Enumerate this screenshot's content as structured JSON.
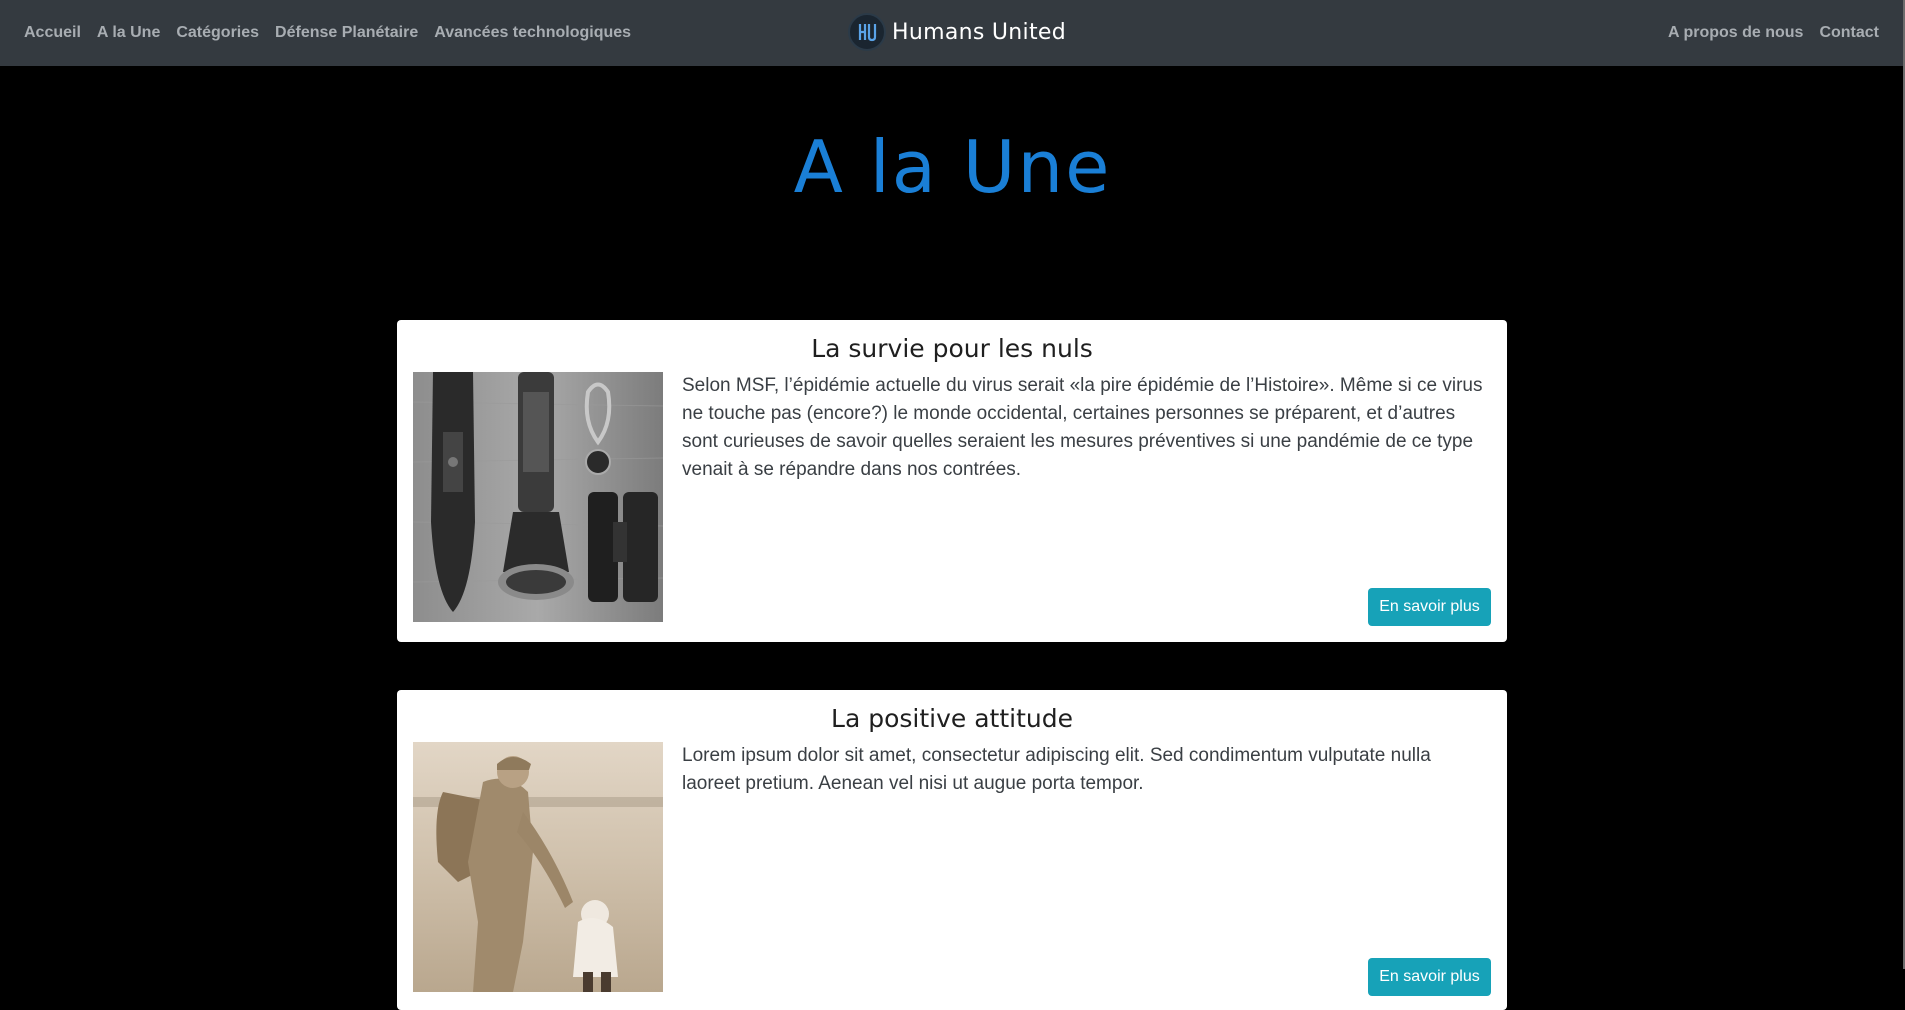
{
  "nav": {
    "left": [
      "Accueil",
      "A la Une",
      "Catégories",
      "Défense Planétaire",
      "Avancées technologiques"
    ],
    "right": [
      "A propos de nous",
      "Contact"
    ],
    "brand": "Humans United"
  },
  "page": {
    "title": "A la Une"
  },
  "articles": [
    {
      "title": "La survie pour les nuls",
      "text": "Selon MSF, l’épidémie actuelle du virus serait «la pire épidémie de l’Histoire». Même si ce virus ne touche pas (encore?) le monde occidental, certaines personnes se préparent, et d’autres sont curieuses de savoir quelles seraient les mesures préventives si une pandémie de ce type venait à se répandre dans nos contrées.",
      "button": "En savoir plus"
    },
    {
      "title": "La positive attitude",
      "text": "Lorem ipsum dolor sit amet, consectetur adipiscing elit. Sed condimentum vulputate nulla laoreet pretium. Aenean vel nisi ut augue porta tempor.",
      "button": "En savoir plus"
    }
  ],
  "colors": {
    "navbar": "#343a40",
    "accent": "#1a7fd6",
    "button": "#17a2b8"
  }
}
